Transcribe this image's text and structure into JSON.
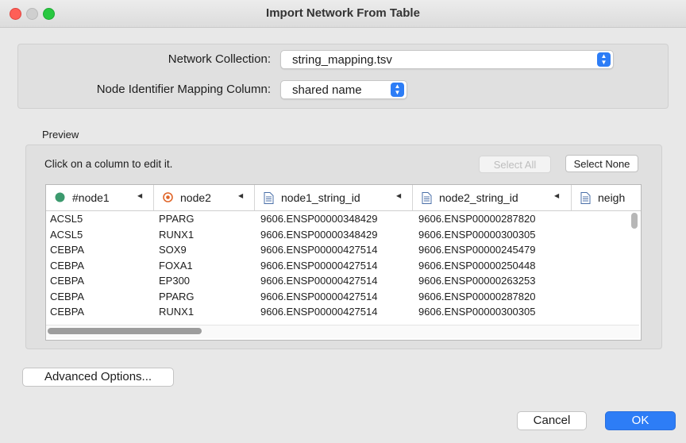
{
  "window": {
    "title": "Import Network From Table"
  },
  "form": {
    "network_collection_label": "Network Collection:",
    "network_collection_value": "string_mapping.tsv",
    "mapping_column_label": "Node Identifier Mapping Column:",
    "mapping_column_value": "shared name"
  },
  "preview": {
    "label": "Preview",
    "hint": "Click on a column to edit it.",
    "select_all": "Select All",
    "select_none": "Select None",
    "columns": [
      {
        "label": "#node1",
        "icon": "source-node-icon"
      },
      {
        "label": "node2",
        "icon": "target-node-icon"
      },
      {
        "label": "node1_string_id",
        "icon": "edge-attribute-icon"
      },
      {
        "label": "node2_string_id",
        "icon": "edge-attribute-icon"
      },
      {
        "label": "neigh",
        "icon": "edge-attribute-icon"
      }
    ],
    "rows": [
      [
        "ACSL5",
        "PPARG",
        "9606.ENSP00000348429",
        "9606.ENSP00000287820"
      ],
      [
        "ACSL5",
        "RUNX1",
        "9606.ENSP00000348429",
        "9606.ENSP00000300305"
      ],
      [
        "CEBPA",
        "SOX9",
        "9606.ENSP00000427514",
        "9606.ENSP00000245479"
      ],
      [
        "CEBPA",
        "FOXA1",
        "9606.ENSP00000427514",
        "9606.ENSP00000250448"
      ],
      [
        "CEBPA",
        "EP300",
        "9606.ENSP00000427514",
        "9606.ENSP00000263253"
      ],
      [
        "CEBPA",
        "PPARG",
        "9606.ENSP00000427514",
        "9606.ENSP00000287820"
      ],
      [
        "CEBPA",
        "RUNX1",
        "9606.ENSP00000427514",
        "9606.ENSP00000300305"
      ]
    ]
  },
  "footer": {
    "advanced_options": "Advanced Options...",
    "cancel": "Cancel",
    "ok": "OK"
  },
  "colors": {
    "accent": "#2d7df6",
    "source_node": "#3c9a6e",
    "target_node": "#e0662a"
  }
}
